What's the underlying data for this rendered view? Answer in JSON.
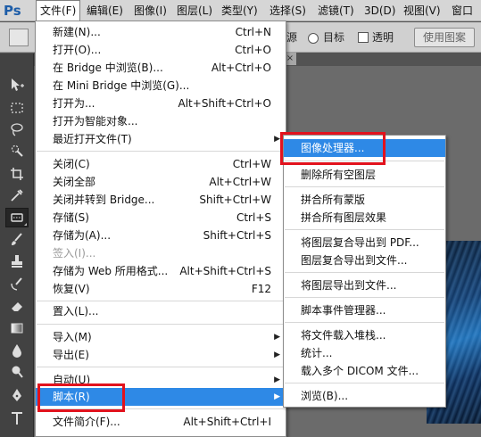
{
  "app": {
    "logo": "Ps"
  },
  "menubar": {
    "items": [
      {
        "label": "文件(F)",
        "active": true
      },
      {
        "label": "编辑(E)"
      },
      {
        "label": "图像(I)"
      },
      {
        "label": "图层(L)"
      },
      {
        "label": "类型(Y)"
      },
      {
        "label": "选择(S)"
      },
      {
        "label": "滤镜(T)"
      },
      {
        "label": "3D(D)"
      },
      {
        "label": "视图(V)"
      },
      {
        "label": "窗口"
      }
    ]
  },
  "options": {
    "source_label": "源",
    "target_label": "目标",
    "transparent_label": "透明",
    "use_pattern_button": "使用图案"
  },
  "doc_tab": {
    "close": "×"
  },
  "tools": [
    {
      "name": "move-tool",
      "icon": "move-icon"
    },
    {
      "name": "marquee-tool",
      "icon": "marquee-icon"
    },
    {
      "name": "lasso-tool",
      "icon": "lasso-icon"
    },
    {
      "name": "quick-select-tool",
      "icon": "quick-select-icon"
    },
    {
      "name": "crop-tool",
      "icon": "crop-icon"
    },
    {
      "name": "eyedropper-tool",
      "icon": "eyedropper-icon"
    },
    {
      "name": "patch-tool",
      "icon": "patch-icon",
      "selected": true
    },
    {
      "name": "brush-tool",
      "icon": "brush-icon"
    },
    {
      "name": "stamp-tool",
      "icon": "stamp-icon"
    },
    {
      "name": "history-brush-tool",
      "icon": "history-brush-icon"
    },
    {
      "name": "eraser-tool",
      "icon": "eraser-icon"
    },
    {
      "name": "gradient-tool",
      "icon": "gradient-icon"
    },
    {
      "name": "blur-tool",
      "icon": "blur-icon"
    },
    {
      "name": "dodge-tool",
      "icon": "dodge-icon"
    },
    {
      "name": "pen-tool",
      "icon": "pen-icon"
    },
    {
      "name": "type-tool",
      "icon": "type-icon"
    }
  ],
  "file_menu": {
    "items": [
      {
        "label": "新建(N)...",
        "shortcut": "Ctrl+N"
      },
      {
        "label": "打开(O)...",
        "shortcut": "Ctrl+O"
      },
      {
        "label": "在 Bridge 中浏览(B)...",
        "shortcut": "Alt+Ctrl+O"
      },
      {
        "label": "在 Mini Bridge 中浏览(G)...",
        "shortcut": ""
      },
      {
        "label": "打开为...",
        "shortcut": "Alt+Shift+Ctrl+O"
      },
      {
        "label": "打开为智能对象...",
        "shortcut": ""
      },
      {
        "label": "最近打开文件(T)",
        "shortcut": "",
        "submenu": true
      },
      {
        "label": "关闭(C)",
        "shortcut": "Ctrl+W"
      },
      {
        "label": "关闭全部",
        "shortcut": "Alt+Ctrl+W"
      },
      {
        "label": "关闭并转到 Bridge...",
        "shortcut": "Shift+Ctrl+W"
      },
      {
        "label": "存储(S)",
        "shortcut": "Ctrl+S"
      },
      {
        "label": "存储为(A)...",
        "shortcut": "Shift+Ctrl+S"
      },
      {
        "label": "签入(I)...",
        "shortcut": "",
        "disabled": true
      },
      {
        "label": "存储为 Web 所用格式...",
        "shortcut": "Alt+Shift+Ctrl+S"
      },
      {
        "label": "恢复(V)",
        "shortcut": "F12"
      },
      {
        "label": "置入(L)...",
        "shortcut": ""
      },
      {
        "label": "导入(M)",
        "shortcut": "",
        "submenu": true
      },
      {
        "label": "导出(E)",
        "shortcut": "",
        "submenu": true
      },
      {
        "label": "自动(U)",
        "shortcut": "",
        "submenu": true
      },
      {
        "label": "脚本(R)",
        "shortcut": "",
        "submenu": true,
        "highlighted": true
      },
      {
        "label": "文件简介(F)...",
        "shortcut": "Alt+Shift+Ctrl+I"
      }
    ]
  },
  "scripts_submenu": {
    "items": [
      {
        "label": "图像处理器...",
        "highlighted": true
      },
      {
        "label": "删除所有空图层"
      },
      {
        "label": "拼合所有蒙版"
      },
      {
        "label": "拼合所有图层效果"
      },
      {
        "label": "将图层复合导出到 PDF..."
      },
      {
        "label": "图层复合导出到文件..."
      },
      {
        "label": "将图层导出到文件..."
      },
      {
        "label": "脚本事件管理器..."
      },
      {
        "label": "将文件载入堆栈..."
      },
      {
        "label": "统计..."
      },
      {
        "label": "载入多个 DICOM 文件..."
      },
      {
        "label": "浏览(B)..."
      }
    ]
  },
  "colors": {
    "highlight": "#2e89e6",
    "annotation_red": "#e2121d"
  }
}
